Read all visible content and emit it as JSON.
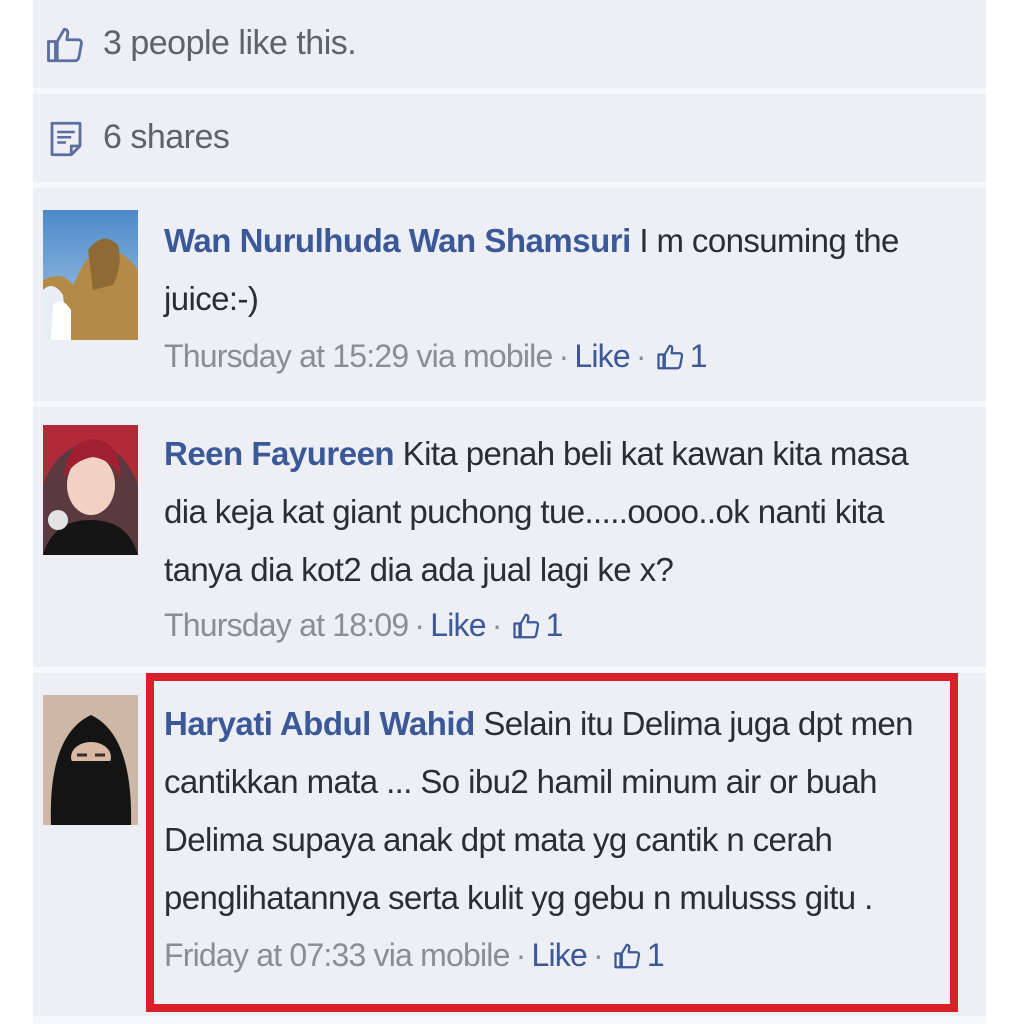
{
  "likes_row": {
    "icon": "thumbs-up-icon",
    "text": "3 people like this."
  },
  "shares_row": {
    "icon": "share-doc-icon",
    "text": "6 shares"
  },
  "comments": [
    {
      "author": "Wan Nurulhuda Wan Shamsuri",
      "text": "I m consuming the juice:-)",
      "time": "Thursday at 15:29 via mobile",
      "like_label": "Like",
      "like_count": "1"
    },
    {
      "author": "Reen Fayureen",
      "text": "Kita penah beli kat kawan kita masa dia keja kat giant puchong tue.....oooo..ok nanti kita tanya dia kot2 dia ada jual lagi ke x?",
      "time": "Thursday at 18:09",
      "like_label": "Like",
      "like_count": "1"
    },
    {
      "author": "Haryati Abdul Wahid",
      "text": "Selain itu Delima juga dpt men cantikkan mata ... So ibu2 hamil minum air or buah Delima supaya anak dpt mata yg cantik n cerah penglihatannya serta kulit yg gebu n mulusss gitu .",
      "time": "Friday at 07:33 via mobile",
      "like_label": "Like",
      "like_count": "1"
    }
  ],
  "colors": {
    "author": "#3b5998",
    "highlight": "#d81f2a",
    "panel": "#edeff4"
  }
}
